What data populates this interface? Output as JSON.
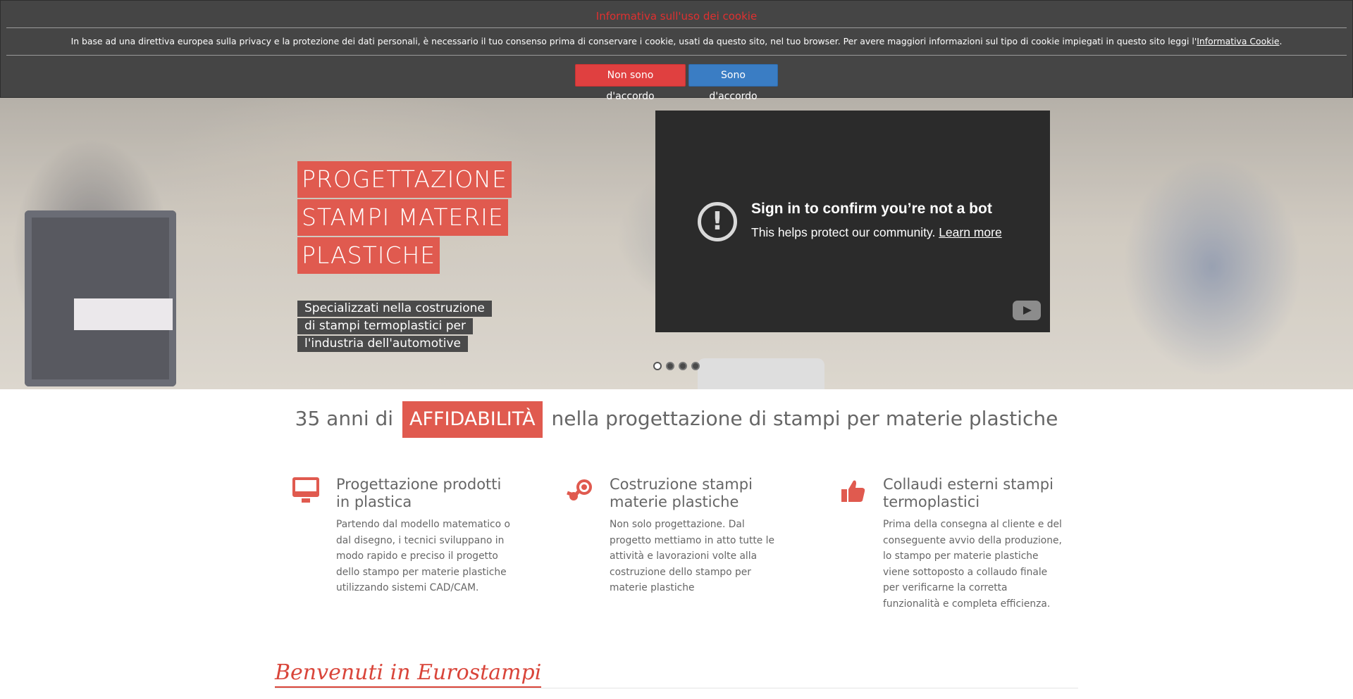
{
  "cookie": {
    "title": "Informativa sull'uso dei cookie",
    "text": "In base ad una direttiva europea sulla privacy e la protezione dei dati personali, è necessario il tuo consenso prima di conservare i cookie, usati da questo sito, nel tuo browser. Per avere maggiori informazioni sul tipo di cookie impiegati in questo sito leggi l'",
    "link_label": "Informativa Cookie",
    "text_end": ".",
    "decline_label": "Non sono d'accordo",
    "accept_label": "Sono d'accordo"
  },
  "hero": {
    "title_lines": [
      "Progettazione",
      "stampi materie",
      "plastiche"
    ],
    "subtitle_lines": [
      "Specializzati nella costruzione",
      "di stampi termoplastici per",
      "l'industria dell'automotive"
    ],
    "slides_count": 4,
    "active_slide": 1
  },
  "video": {
    "heading": "Sign in to confirm you’re not a bot",
    "text": "This helps protect our community.",
    "link_label": "Learn more",
    "warning_icon": "exclamation-circle-icon",
    "logo_icon": "youtube-play-icon"
  },
  "tagline": {
    "before": "35 anni di",
    "highlight": "Affidabilità",
    "after": "nella progettazione di stampi per materie plastiche"
  },
  "features": [
    {
      "icon": "monitor-icon",
      "title": "Progettazione prodotti in plastica",
      "body": "Partendo dal modello matematico o dal disegno, i tecnici sviluppano in modo rapido e preciso il progetto dello stampo per materie plastiche utilizzando sistemi CAD/CAM."
    },
    {
      "icon": "steam-icon",
      "title": "Costruzione stampi materie plastiche",
      "body": "Non solo progettazione. Dal progetto mettiamo in atto tutte le attività e lavorazioni volte alla costruzione dello stampo per materie plastiche"
    },
    {
      "icon": "thumbs-up-icon",
      "title": "Collaudi esterni stampi termoplastici",
      "body": "Prima della consegna al cliente e del conseguente avvio della produzione, lo stampo per materie plastiche viene sottoposto a collaudo finale per verificarne la corretta funzionalità e completa efficienza."
    }
  ],
  "welcome": {
    "title": "Benvenuti in Eurostampi"
  },
  "colors": {
    "accent": "#e05a4f",
    "cookie_bg": "#454545",
    "decline": "#e04040",
    "accept": "#3a7dc4"
  }
}
